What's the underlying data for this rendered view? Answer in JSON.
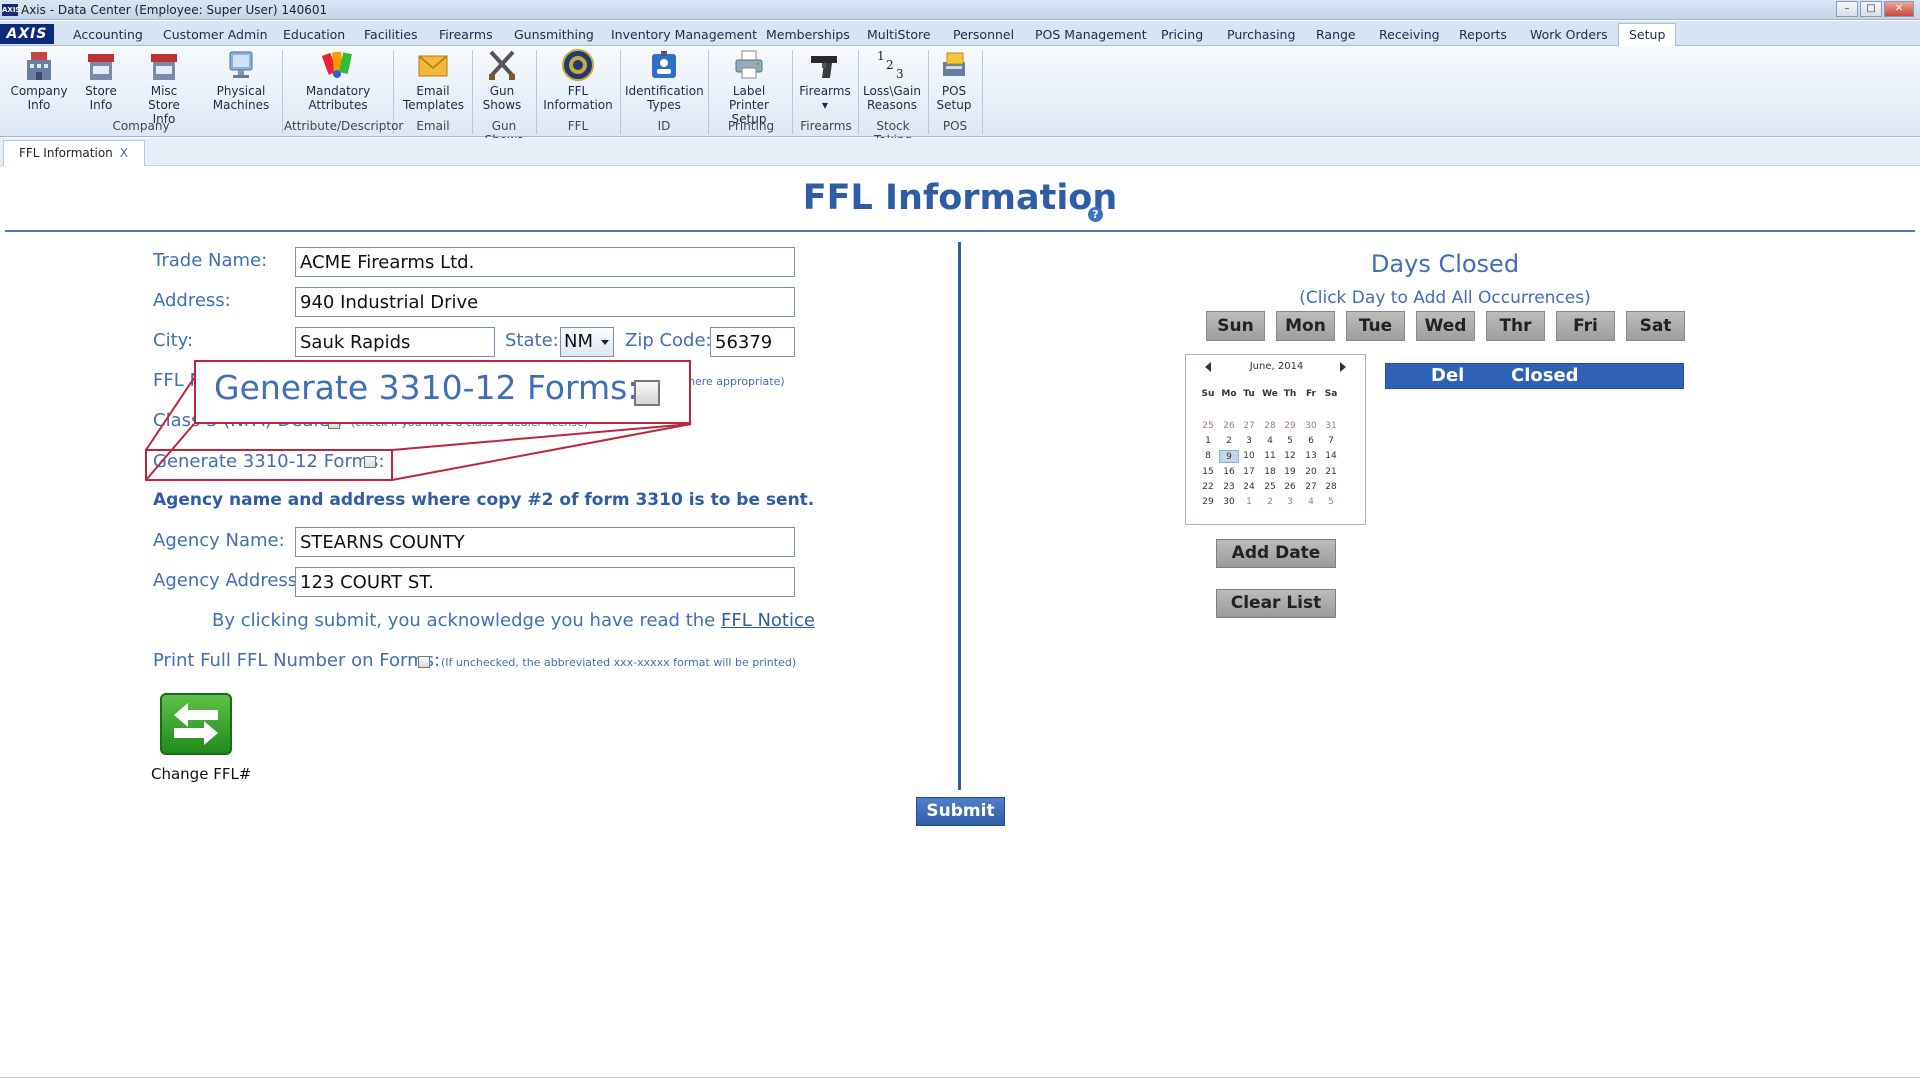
{
  "window": {
    "title": "Axis - Data Center  (Employee: Super User) 140601",
    "logo_text": "AXIS",
    "min": "–",
    "max": "□",
    "close": "✕"
  },
  "menu": {
    "brand": "AXIS",
    "tabs": [
      "Accounting",
      "Customer Admin",
      "Education",
      "Facilities",
      "Firearms",
      "Gunsmithing",
      "Inventory Management",
      "Memberships",
      "MultiStore",
      "Personnel",
      "POS Management",
      "Pricing",
      "Purchasing",
      "Range",
      "Receiving",
      "Reports",
      "Work Orders",
      "Setup"
    ],
    "active": "Setup"
  },
  "ribbon": {
    "buttons": [
      {
        "label1": "Company",
        "label2": "Info"
      },
      {
        "label1": "Store",
        "label2": "Info"
      },
      {
        "label1": "Misc Store",
        "label2": "Info"
      },
      {
        "label1": "Physical",
        "label2": "Machines"
      },
      {
        "label1": "Mandatory",
        "label2": "Attributes"
      },
      {
        "label1": "Email",
        "label2": "Templates"
      },
      {
        "label1": "Gun",
        "label2": "Shows"
      },
      {
        "label1": "FFL",
        "label2": "Information"
      },
      {
        "label1": "Identification",
        "label2": "Types"
      },
      {
        "label1": "Label Printer",
        "label2": "Setup"
      },
      {
        "label1": "Firearms",
        "label2": "▾"
      },
      {
        "label1": "Loss\\Gain",
        "label2": "Reasons"
      },
      {
        "label1": "POS",
        "label2": "Setup"
      }
    ],
    "groups": [
      "Company",
      "Attribute/Descriptor",
      "Email",
      "Gun Shows",
      "FFL",
      "ID",
      "Printing",
      "Firearms",
      "Stock Taking",
      "POS"
    ]
  },
  "doc_tab": {
    "label": "FFL Information",
    "close": "X"
  },
  "page": {
    "title": "FFL Information",
    "help": "?"
  },
  "form": {
    "trade_name_label": "Trade Name:",
    "trade_name_value": "ACME Firearms Ltd.",
    "address_label": "Address:",
    "address_value": "940 Industrial Drive",
    "city_label": "City:",
    "city_value": "Sauk Rapids",
    "state_label": "State:",
    "state_value": "NM",
    "zip_label": "Zip Code:",
    "zip_value": "56379",
    "ffl_label_partial": "FFL N",
    "ffl_hint_partial": "here appropriate)",
    "class3_label": "Class 3 (NFA) Dealer:",
    "class3_hint": "(check if you have a class 3 dealer license)",
    "gen_forms_label": "Generate 3310-12 Forms:",
    "agency_heading": "Agency name and address where copy #2 of form 3310 is to be sent.",
    "agency_name_label": "Agency Name:",
    "agency_name_value": "STEARNS COUNTY",
    "agency_address_label": "Agency Address:",
    "agency_address_value": "123 COURT ST.",
    "ack_prefix": "By clicking submit, you acknowledge you have read the",
    "ack_link": "FFL Notice",
    "print_full_label": "Print Full FFL Number on Forms:",
    "print_full_hint": "(If unchecked, the abbreviated xxx-xxxxx format will be printed)",
    "change_ffl_label": "Change FFL#",
    "submit_label": "Submit"
  },
  "callout": {
    "text": "Generate 3310-12 Forms:"
  },
  "days_closed": {
    "title": "Days Closed",
    "subtitle": "(Click Day to Add All Occurrences)",
    "days": [
      "Sun",
      "Mon",
      "Tue",
      "Wed",
      "Thr",
      "Fri",
      "Sat"
    ],
    "list_headers": [
      "Del",
      "Closed"
    ],
    "add_date": "Add Date",
    "clear_list": "Clear List"
  },
  "calendar": {
    "month": "June, 2014",
    "dow": [
      "Su",
      "Mo",
      "Tu",
      "We",
      "Th",
      "Fr",
      "Sa"
    ],
    "weeks": [
      [
        [
          "25",
          1
        ],
        [
          "26",
          1
        ],
        [
          "27",
          1
        ],
        [
          "28",
          1
        ],
        [
          "29",
          1
        ],
        [
          "30",
          1
        ],
        [
          "31",
          1
        ]
      ],
      [
        [
          "1",
          0
        ],
        [
          "2",
          0
        ],
        [
          "3",
          0
        ],
        [
          "4",
          0
        ],
        [
          "5",
          0
        ],
        [
          "6",
          0
        ],
        [
          "7",
          0
        ]
      ],
      [
        [
          "8",
          0
        ],
        [
          "9",
          2
        ],
        [
          "10",
          0
        ],
        [
          "11",
          0
        ],
        [
          "12",
          0
        ],
        [
          "13",
          0
        ],
        [
          "14",
          0
        ]
      ],
      [
        [
          "15",
          0
        ],
        [
          "16",
          0
        ],
        [
          "17",
          0
        ],
        [
          "18",
          0
        ],
        [
          "19",
          0
        ],
        [
          "20",
          0
        ],
        [
          "21",
          0
        ]
      ],
      [
        [
          "22",
          0
        ],
        [
          "23",
          0
        ],
        [
          "24",
          0
        ],
        [
          "25",
          0
        ],
        [
          "26",
          0
        ],
        [
          "27",
          0
        ],
        [
          "28",
          0
        ]
      ],
      [
        [
          "29",
          0
        ],
        [
          "30",
          0
        ],
        [
          "1",
          1
        ],
        [
          "2",
          1
        ],
        [
          "3",
          1
        ],
        [
          "4",
          1
        ],
        [
          "5",
          1
        ]
      ]
    ]
  }
}
